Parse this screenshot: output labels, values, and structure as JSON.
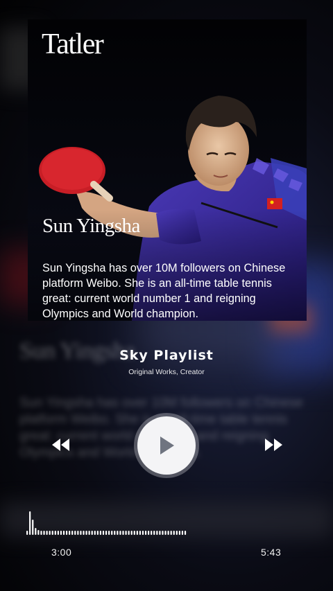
{
  "card": {
    "brand": "Tatler",
    "headline": "Sun Yingsha",
    "description": "Sun Yingsha has over 10M followers on Chinese platform Weibo. She is an all-time table tennis great: current world number 1 and reigning Olympics and World champion."
  },
  "player": {
    "track_title": "Sky Playlist",
    "track_subtitle": "Original Works, Creator",
    "current_time": "3:00",
    "total_time": "5:43",
    "progress": 0.52
  },
  "icons": {
    "rewind": "rewind-icon",
    "play": "play-icon",
    "forward": "fast-forward-icon"
  },
  "colors": {
    "background": "#050507",
    "play_button": "#f4f4f6",
    "play_glyph": "#6f7480",
    "jersey": "#3b2fa0",
    "paddle": "#c81e26"
  }
}
